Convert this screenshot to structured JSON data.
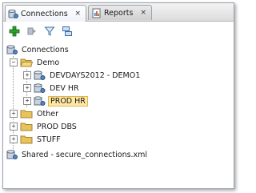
{
  "tabs": [
    {
      "label": "Connections",
      "close": "×",
      "icon": "connections-icon"
    },
    {
      "label": "Reports",
      "close": "×",
      "icon": "reports-icon"
    }
  ],
  "toolbar": {
    "buttons": [
      "add-connection-icon",
      "refresh-icon",
      "filter-icon",
      "schema-browser-icon"
    ]
  },
  "tree": {
    "root": "Connections",
    "demo": "Demo",
    "demo_children": [
      "DEVDAYS2012 - DEMO1",
      "DEV HR",
      "PROD HR"
    ],
    "other": "Other",
    "prod_dbs": "PROD DBS",
    "stuff": "STUFF",
    "shared": "Shared - secure_connections.xml",
    "selected": "PROD HR"
  },
  "colors": {
    "selection_bg": "#fde8a6",
    "selection_border": "#e5b54f",
    "folder": "#e8c25a",
    "add_green": "#2e9e2e"
  }
}
